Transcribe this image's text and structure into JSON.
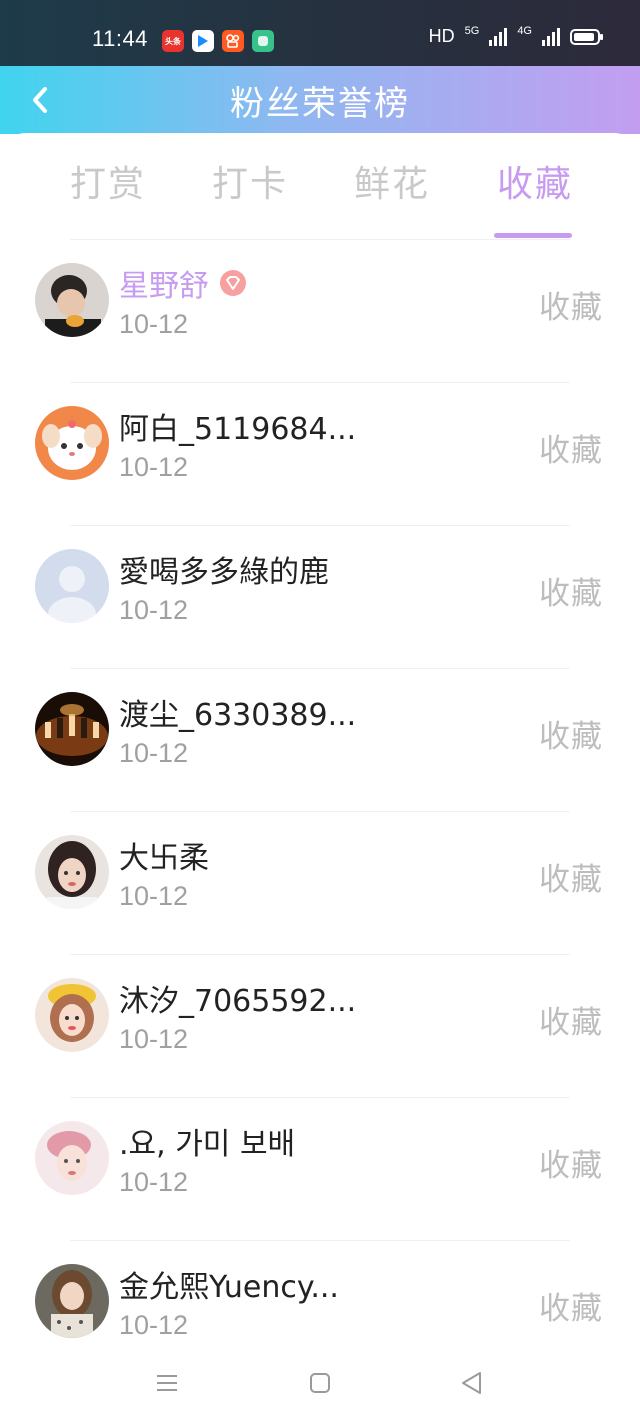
{
  "status_bar": {
    "time": "11:44",
    "app_icons": [
      {
        "name": "toutiao-icon",
        "label": "头条",
        "color": "#e8332e"
      },
      {
        "name": "youku-icon",
        "label": "YOUKU",
        "color": "#1a8cff"
      },
      {
        "name": "kuaishou-icon",
        "label": "",
        "color": "#ff5a1f"
      },
      {
        "name": "app-green-icon",
        "label": "",
        "color": "#36c28a"
      }
    ],
    "hd_label": "HD",
    "net_5g": "5G",
    "net_4g": "4G"
  },
  "header": {
    "back_icon": "chevron-left-icon",
    "title": "粉丝荣誉榜"
  },
  "tabs": [
    {
      "label": "打赏",
      "active": false
    },
    {
      "label": "打卡",
      "active": false
    },
    {
      "label": "鲜花",
      "active": false
    },
    {
      "label": "收藏",
      "active": true
    }
  ],
  "colors": {
    "accent": "#c79cf0",
    "header_gradient_start": "#40d4ee",
    "header_gradient_end": "#c39ef0",
    "muted": "#bdbdbd"
  },
  "fans": [
    {
      "name": "星野舒",
      "date": "10-12",
      "action": "收藏",
      "highlight": true,
      "badge": "diamond-badge-icon"
    },
    {
      "name": "阿白_5119684...",
      "date": "10-12",
      "action": "收藏",
      "highlight": false
    },
    {
      "name": "愛喝多多綠的鹿",
      "date": "10-12",
      "action": "收藏",
      "highlight": false
    },
    {
      "name": "渡尘_6330389...",
      "date": "10-12",
      "action": "收藏",
      "highlight": false
    },
    {
      "name": "大卐柔",
      "date": "10-12",
      "action": "收藏",
      "highlight": false
    },
    {
      "name": "沐汐_7065592...",
      "date": "10-12",
      "action": "收藏",
      "highlight": false
    },
    {
      "name": ".요, 가미 보배",
      "date": "10-12",
      "action": "收藏",
      "highlight": false
    },
    {
      "name": "金允熙Yuency...",
      "date": "10-12",
      "action": "收藏",
      "highlight": false
    }
  ],
  "navbar": {
    "menu_icon": "menu-icon",
    "home_icon": "home-square-icon",
    "back_icon": "back-triangle-icon"
  }
}
